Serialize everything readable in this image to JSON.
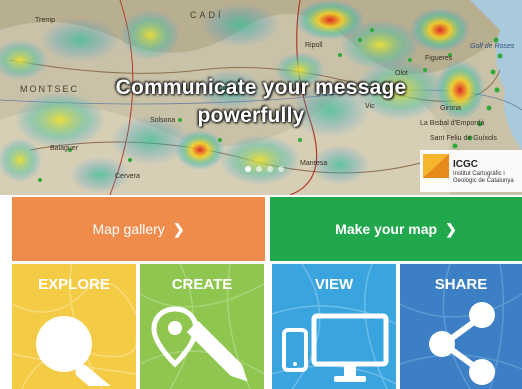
{
  "hero": {
    "headline_line1": "Communicate your message",
    "headline_line2": "powerfully",
    "slides": 4,
    "active_slide": 0,
    "map_labels": [
      "CADÍ",
      "Ripoll",
      "Figueres",
      "Manresa",
      "Solsona",
      "Balaguer",
      "Cervera",
      "Girona",
      "Vic",
      "Olot",
      "La Bisbal d'Empordà",
      "MONTSEC",
      "Tremp",
      "Golf de Roses",
      "Sant Feliu de Guíxols"
    ],
    "logo": {
      "brand": "ICGC",
      "subname": "Institut Cartogràfic i Geològic de Catalunya"
    }
  },
  "banners": {
    "gallery_label": "Map gallery",
    "make_label": "Make your map"
  },
  "tiles": {
    "explore": "EXPLORE",
    "create": "CREATE",
    "view": "VIEW",
    "share": "SHARE"
  },
  "colors": {
    "orange": "#ef8c4c",
    "green": "#22a84c",
    "yellow": "#f4cb45",
    "lime": "#8fc64f",
    "lightblue": "#3aa4df",
    "blue": "#3c7fc4"
  }
}
